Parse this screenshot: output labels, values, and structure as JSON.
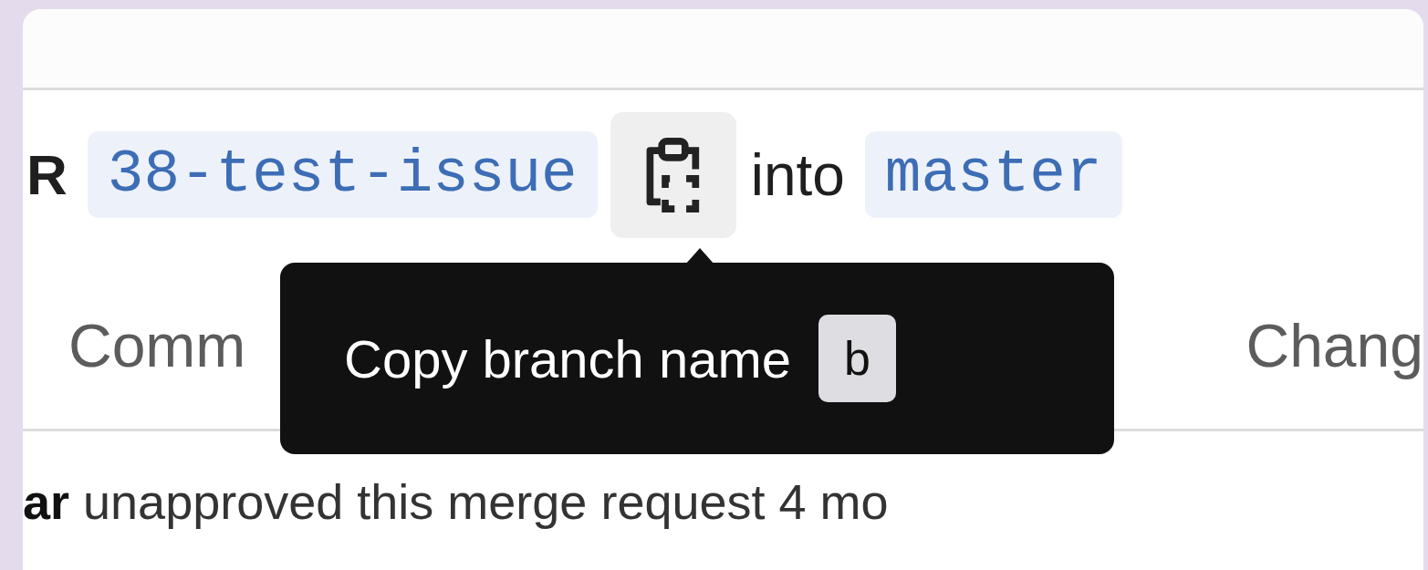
{
  "header": {
    "prefix": "R",
    "source_branch": "38-test-issue",
    "connector": "into",
    "target_branch": "master"
  },
  "copy_button": {
    "tooltip": "Copy branch name",
    "shortcut": "b"
  },
  "tabs": [
    {
      "label": "Comm",
      "selected": false
    },
    {
      "label": "Chang",
      "selected": false
    }
  ],
  "activity": "**ar** unapproved this merge request 4 mo"
}
